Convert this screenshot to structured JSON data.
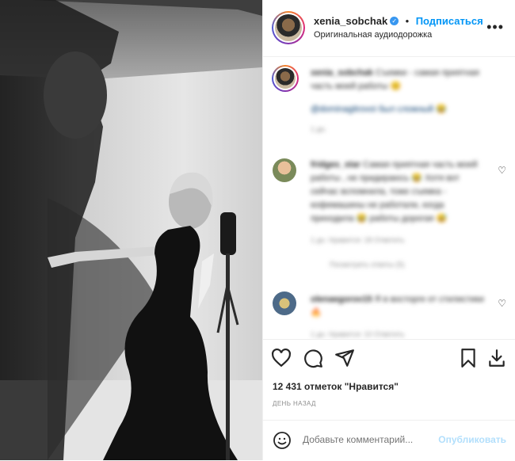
{
  "post": {
    "username": "xenia_sobchak",
    "follow_label": "Подписаться",
    "audio": "Оригинальная аудиодорожка",
    "more_label": "•••"
  },
  "comments": [
    {
      "username": "xenia_sobchak",
      "text": "Съемки - самая приятная часть моей работы 😊",
      "mention": "@dominagitrovoi был сложный 😂",
      "meta": "1 дн."
    },
    {
      "username": "fridges_star",
      "text": "Самая приятная часть моей работы , не придираюсь 😂 Хотя вот сейчас вспомнила, тоже съемка - кофемашины не работали, когда приходила 😂 работы дорогая 😅",
      "meta": "1 дн.   Нравится: 18   Ответить",
      "replies": "Посмотреть ответы (5)"
    },
    {
      "username": "olenaegorov15",
      "text": "Я в восторге от стилистики 🔥",
      "meta": "1 дн.   Нравится: 10   Ответить"
    }
  ],
  "likes": "12 431 отметок \"Нравится\"",
  "time_ago": "ДЕНЬ НАЗАД",
  "compose": {
    "placeholder": "Добавьте комментарий...",
    "publish_label": "Опубликовать"
  }
}
